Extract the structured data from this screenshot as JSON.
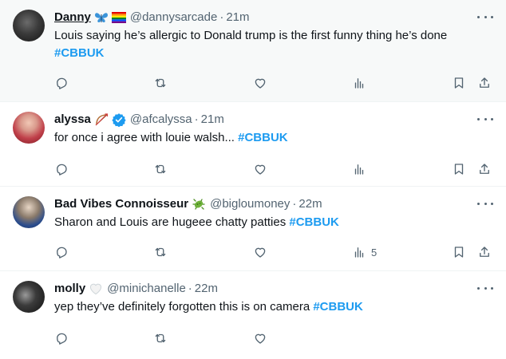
{
  "tweets": [
    {
      "name": "Danny",
      "name_underlined": true,
      "emoji": [
        "butterfly",
        "rainbow-flag"
      ],
      "handle": "@dannysarcade",
      "time": "21m",
      "text": "Louis saying he’s allergic to Donald trump is the first funny thing he’s done ",
      "hashtag": "#CBBUK",
      "views": ""
    },
    {
      "name": "alyssa",
      "name_underlined": false,
      "emoji": [
        "bow-and-arrow",
        "verified-badge"
      ],
      "handle": "@afcalyssa",
      "time": "21m",
      "text": "for once i agree with louie walsh... ",
      "hashtag": "#CBBUK",
      "views": ""
    },
    {
      "name": "Bad Vibes Connoisseur",
      "name_underlined": false,
      "emoji": [
        "microbe"
      ],
      "handle": "@bigloumoney",
      "time": "22m",
      "text": "Sharon and Louis are hugeee chatty patties ",
      "hashtag": "#CBBUK",
      "views": "5"
    },
    {
      "name": "molly",
      "name_underlined": false,
      "emoji": [
        "white-heart"
      ],
      "handle": "@minichanelle",
      "time": "22m",
      "text": "yep they’ve definitely forgotten this is on camera ",
      "hashtag": "#CBBUK",
      "views": ""
    }
  ],
  "separator": "·",
  "colors": {
    "text": "#0f1419",
    "muted": "#536471",
    "hashtag": "#1d9bf0",
    "verified": "#1d9bf0",
    "hover_bg": "#f7f9f9"
  },
  "icons": [
    "reply-icon",
    "retweet-icon",
    "like-icon",
    "views-icon",
    "bookmark-icon",
    "share-icon",
    "more-icon"
  ]
}
